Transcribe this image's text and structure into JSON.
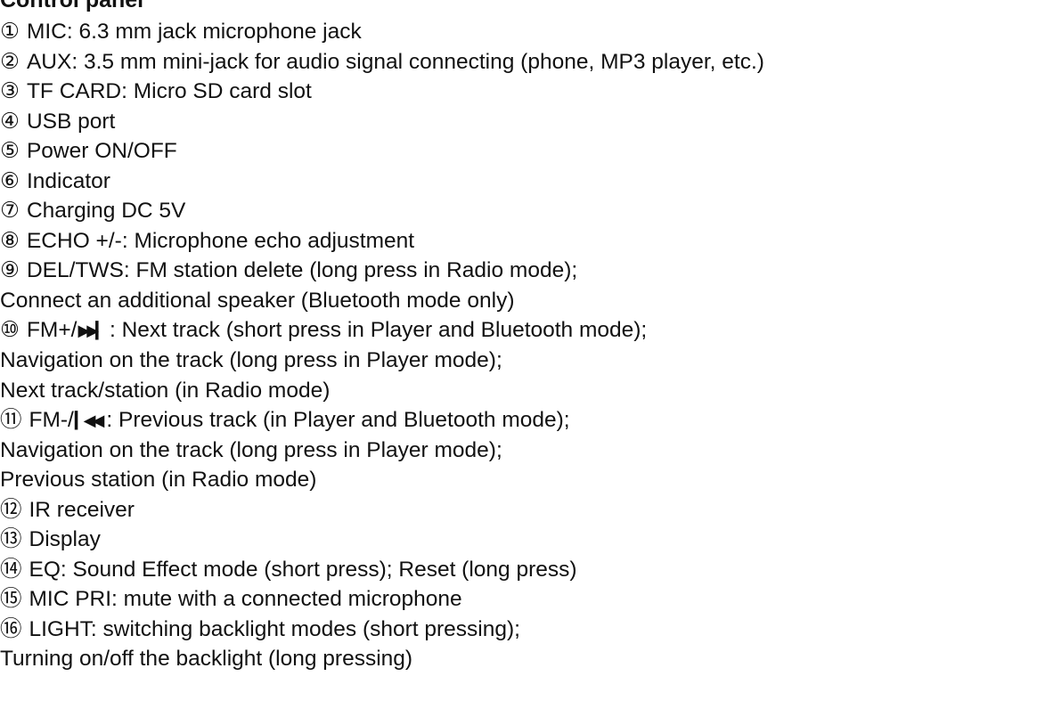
{
  "heading": "Control panel",
  "items": [
    {
      "num": "①",
      "text": "MIC: 6.3 mm jack microphone jack"
    },
    {
      "num": "②",
      "text": "AUX: 3.5 mm mini-jack for audio signal connecting (phone, MP3 player, etc.)"
    },
    {
      "num": "③",
      "text": "TF CARD: Micro SD card slot"
    },
    {
      "num": "④",
      "text": "USB port"
    },
    {
      "num": "⑤",
      "text": "Power ON/OFF"
    },
    {
      "num": "⑥",
      "text": "Indicator"
    },
    {
      "num": "⑦",
      "text": "Charging DC 5V"
    },
    {
      "num": "⑧",
      "text": "ECHO +/-: Microphone echo adjustment"
    },
    {
      "num": "⑨",
      "text": "DEL/TWS: FM station delete (long press in Radio mode);"
    },
    {
      "text": "Connect an additional speaker (Bluetooth mode only)"
    },
    {
      "num": "⑩",
      "prefix": "FM+/",
      "symbol": "▶▶▎",
      "text": ": Next track (short press in Player and Bluetooth mode);"
    },
    {
      "text": "Navigation on the track (long press in Player mode);"
    },
    {
      "text": "Next track/station (in Radio mode)"
    },
    {
      "num": "⑪",
      "prefix": "FM-/",
      "symbol": "▎◀◀",
      "text": ": Previous track (in Player and Bluetooth mode);"
    },
    {
      "text": "Navigation on the track (long press in Player mode);"
    },
    {
      "text": "Previous station (in Radio mode)"
    },
    {
      "num": "⑫",
      "text": "IR receiver"
    },
    {
      "num": "⑬",
      "text": "Display"
    },
    {
      "num": "⑭",
      "text": "EQ: Sound Effect mode (short press); Reset (long press)"
    },
    {
      "num": "⑮",
      "text": "MIC PRI: mute with a connected microphone"
    },
    {
      "num": "⑯",
      "text": "LIGHT: switching backlight modes (short pressing);"
    },
    {
      "text": "Turning on/off the backlight (long pressing)"
    }
  ]
}
